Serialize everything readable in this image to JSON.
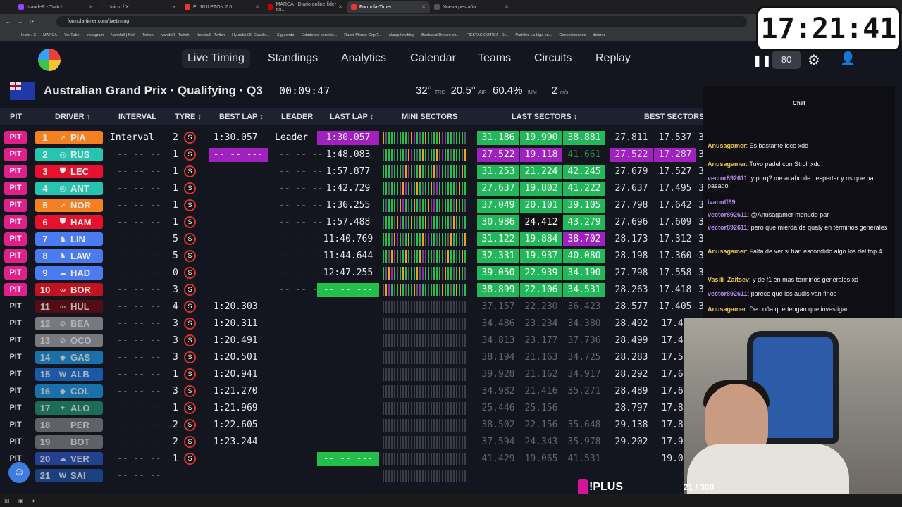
{
  "browser": {
    "tabs": [
      "tvandeR - Twitch",
      "Inicio / X",
      "EL RULETON 2.0",
      "MARCA - Diario online líder en...",
      "Formula-Timer",
      "Nueva pestaña"
    ],
    "url": "formula-timer.com/livetiming",
    "bookmarks": [
      "Inicio / X",
      "MARCA",
      "YouTube",
      "Instagram",
      "Nancla3 | Kick",
      "Twitch",
      "tvandeR - Twitch",
      "Nancla3 - Twitch",
      "Hyundai i30 Gasolin...",
      "Siguiendo",
      "Estado del servicio...",
      "Razer Mouse Grip T...",
      "alangulotv.blog",
      "Backseat Drivers en...",
      "FIESTAS GUIRCA | Di...",
      "Partidos La Liga en...",
      "Concesionarios",
      "dolares"
    ]
  },
  "clock": "17:21:41",
  "nav": {
    "items": [
      "Live Timing",
      "Standings",
      "Analytics",
      "Calendar",
      "Teams",
      "Circuits",
      "Replay"
    ],
    "speed": "80"
  },
  "session": {
    "title": "Australian Grand Prix · Qualifying · Q3",
    "timer": "00:09:47",
    "track_temp": "32°",
    "track_label": "TRC",
    "air_temp": "20.5°",
    "air_label": "AIR",
    "humidity": "60.4%",
    "hum_label": "HUM",
    "wind": "2",
    "wind_unit": "m/s"
  },
  "headers": [
    "PIT",
    "DRIVER ↑",
    "INTERVAL",
    "TYRE ↕",
    "BEST LAP ↕",
    "LEADER",
    "LAST LAP ↕",
    "MINI SECTORS",
    "LAST SECTORS ↕",
    "BEST SECTORS"
  ],
  "rows": [
    {
      "pit": "PIT",
      "pos": "1",
      "code": "PIA",
      "icon": "➚",
      "color": "#f58020",
      "interval": "Interval",
      "laps": "2",
      "best": "1:30.057",
      "leader": "Leader",
      "last": "1:30.057",
      "last_bg": "#a020c0",
      "s": [
        "31.186",
        "19.990",
        "38.881"
      ],
      "sbg": [
        "#22b85a",
        "#22b85a",
        "#22b85a"
      ],
      "b": [
        "27.811",
        "17.537",
        "3"
      ]
    },
    {
      "pit": "PIT",
      "pos": "2",
      "code": "RUS",
      "icon": "◎",
      "color": "#27c4b0",
      "interval": "-- -- --",
      "laps": "1",
      "best": "-- -- ---",
      "leader": "-- -- --",
      "last": "1:48.083",
      "last_bg": "",
      "s": [
        "27.522",
        "19.118",
        "41.661"
      ],
      "sbg": [
        "#a020c0",
        "#a020c0",
        ""
      ],
      "b": [
        "27.522",
        "17.287",
        "3"
      ]
    },
    {
      "pit": "PIT",
      "pos": "3",
      "code": "LEC",
      "icon": "⛊",
      "color": "#e8112d",
      "interval": "-- -- --",
      "laps": "1",
      "best": "",
      "leader": "-- -- --",
      "last": "1:57.877",
      "last_bg": "",
      "s": [
        "31.253",
        "21.224",
        "42.245"
      ],
      "sbg": [
        "",
        "",
        ""
      ],
      "b": [
        "27.679",
        "17.527",
        "3"
      ]
    },
    {
      "pit": "PIT",
      "pos": "4",
      "code": "ANT",
      "icon": "◎",
      "color": "#27c4b0",
      "interval": "-- -- --",
      "laps": "1",
      "best": "",
      "leader": "-- -- --",
      "last": "1:42.729",
      "last_bg": "",
      "s": [
        "27.637",
        "19.802",
        "41.222"
      ],
      "sbg": [
        "",
        "",
        ""
      ],
      "b": [
        "27.637",
        "17.495",
        "3"
      ]
    },
    {
      "pit": "PIT",
      "pos": "5",
      "code": "NOR",
      "icon": "➚",
      "color": "#f58020",
      "interval": "-- -- --",
      "laps": "1",
      "best": "",
      "leader": "-- -- --",
      "last": "1:36.255",
      "last_bg": "",
      "s": [
        "37.049",
        "20.101",
        "39.105"
      ],
      "sbg": [
        "",
        "",
        ""
      ],
      "b": [
        "27.798",
        "17.642",
        "3"
      ]
    },
    {
      "pit": "PIT",
      "pos": "6",
      "code": "HAM",
      "icon": "⛊",
      "color": "#e8112d",
      "interval": "-- -- --",
      "laps": "1",
      "best": "",
      "leader": "-- -- --",
      "last": "1:57.488",
      "last_bg": "",
      "s": [
        "30.986",
        "24.412",
        "43.279"
      ],
      "sbg": [
        "",
        "#111",
        ""
      ],
      "b": [
        "27.696",
        "17.609",
        "3"
      ]
    },
    {
      "pit": "PIT",
      "pos": "7",
      "code": "LIN",
      "icon": "♞",
      "color": "#4b7bf0",
      "interval": "-- -- --",
      "laps": "5",
      "best": "",
      "leader": "-- -- --",
      "last": "11:40.769",
      "last_bg": "",
      "s": [
        "31.122",
        "19.884",
        "38.702"
      ],
      "sbg": [
        "",
        "",
        "#a020c0"
      ],
      "b": [
        "28.173",
        "17.312",
        "3"
      ]
    },
    {
      "pit": "PIT",
      "pos": "8",
      "code": "LAW",
      "icon": "♞",
      "color": "#4b7bf0",
      "interval": "-- -- --",
      "laps": "5",
      "best": "",
      "leader": "-- -- --",
      "last": "11:44.644",
      "last_bg": "",
      "s": [
        "32.331",
        "19.937",
        "40.080"
      ],
      "sbg": [
        "",
        "",
        ""
      ],
      "b": [
        "28.198",
        "17.360",
        "3"
      ]
    },
    {
      "pit": "PIT",
      "pos": "9",
      "code": "HAD",
      "icon": "☁",
      "color": "#4b7bf0",
      "interval": "-- -- --",
      "laps": "0",
      "best": "",
      "leader": "-- -- --",
      "last": "12:47.255",
      "last_bg": "",
      "s": [
        "39.050",
        "22.939",
        "34.190"
      ],
      "sbg": [
        "",
        "",
        ""
      ],
      "b": [
        "27.798",
        "17.558",
        "3"
      ]
    },
    {
      "pit": "PIT",
      "pos": "10",
      "code": "BOR",
      "icon": "∞",
      "color": "#c0121f",
      "interval": "-- -- --",
      "laps": "3",
      "best": "",
      "leader": "-- -- --",
      "last": "-- -- ---",
      "last_bg": "#22c04a",
      "s": [
        "38.899",
        "22.106",
        "34.531"
      ],
      "sbg": [
        "",
        "",
        ""
      ],
      "b": [
        "28.263",
        "17.418",
        "3"
      ]
    },
    {
      "pit": "PIT",
      "pos": "11",
      "code": "HUL",
      "icon": "∞",
      "color": "#6a0a12",
      "interval": "-- -- --",
      "laps": "4",
      "best": "1:20.303",
      "leader": "",
      "last": "",
      "last_bg": "",
      "s": [
        "37.157",
        "22.230",
        "36.423"
      ],
      "sbg": [
        "",
        "",
        ""
      ],
      "b": [
        "28.577",
        "17.405",
        "3"
      ]
    },
    {
      "pit": "PIT",
      "pos": "12",
      "code": "BEA",
      "icon": "⊘",
      "color": "#9a9aa0",
      "interval": "-- -- --",
      "laps": "3",
      "best": "1:20.311",
      "leader": "",
      "last": "",
      "last_bg": "",
      "s": [
        "34.486",
        "23.234",
        "34.380"
      ],
      "sbg": [
        "",
        "",
        ""
      ],
      "b": [
        "28.492",
        "17.40",
        ""
      ]
    },
    {
      "pit": "PIT",
      "pos": "13",
      "code": "OCO",
      "icon": "⊘",
      "color": "#9a9aa0",
      "interval": "-- -- --",
      "laps": "3",
      "best": "1:20.491",
      "leader": "",
      "last": "",
      "last_bg": "",
      "s": [
        "34.813",
        "23.177",
        "37.736"
      ],
      "sbg": [
        "",
        "",
        ""
      ],
      "b": [
        "28.499",
        "17.46",
        ""
      ]
    },
    {
      "pit": "PIT",
      "pos": "14",
      "code": "GAS",
      "icon": "◆",
      "color": "#1d8fd6",
      "interval": "-- -- --",
      "laps": "3",
      "best": "1:20.501",
      "leader": "",
      "last": "",
      "last_bg": "",
      "s": [
        "38.194",
        "21.163",
        "34.725"
      ],
      "sbg": [
        "",
        "",
        ""
      ],
      "b": [
        "28.283",
        "17.55",
        ""
      ]
    },
    {
      "pit": "PIT",
      "pos": "15",
      "code": "ALB",
      "icon": "W",
      "color": "#1d6fd6",
      "interval": "-- -- --",
      "laps": "1",
      "best": "1:20.941",
      "leader": "",
      "last": "",
      "last_bg": "",
      "s": [
        "39.928",
        "21.162",
        "34.917"
      ],
      "sbg": [
        "",
        "",
        ""
      ],
      "b": [
        "28.292",
        "17.67",
        ""
      ]
    },
    {
      "pit": "PIT",
      "pos": "16",
      "code": "COL",
      "icon": "◆",
      "color": "#1d8fd6",
      "interval": "-- -- --",
      "laps": "3",
      "best": "1:21.270",
      "leader": "",
      "last": "",
      "last_bg": "",
      "s": [
        "34.982",
        "21.416",
        "35.271"
      ],
      "sbg": [
        "",
        "",
        ""
      ],
      "b": [
        "28.489",
        "17.62",
        ""
      ]
    },
    {
      "pit": "PIT",
      "pos": "17",
      "code": "ALO",
      "icon": "✦",
      "color": "#1f8a6a",
      "interval": "-- -- --",
      "laps": "1",
      "best": "1:21.969",
      "leader": "",
      "last": "",
      "last_bg": "",
      "s": [
        "25.446",
        "25.156",
        "",
        ""
      ],
      "sbg": [
        "",
        "",
        ""
      ],
      "b": [
        "28.797",
        "17.80",
        ""
      ]
    },
    {
      "pit": "PIT",
      "pos": "18",
      "code": "PER",
      "icon": "",
      "color": "#7a7a80",
      "interval": "-- -- --",
      "laps": "2",
      "best": "1:22.605",
      "leader": "",
      "last": "",
      "last_bg": "",
      "s": [
        "38.502",
        "22.156",
        "35.648"
      ],
      "sbg": [
        "",
        "",
        ""
      ],
      "b": [
        "29.138",
        "17.81",
        ""
      ]
    },
    {
      "pit": "PIT",
      "pos": "19",
      "code": "BOT",
      "icon": "",
      "color": "#7a7a80",
      "interval": "-- -- --",
      "laps": "2",
      "best": "1:23.244",
      "leader": "",
      "last": "",
      "last_bg": "",
      "s": [
        "37.594",
        "24.343",
        "35.978"
      ],
      "sbg": [
        "",
        "",
        ""
      ],
      "b": [
        "29.202",
        "17.94",
        ""
      ]
    },
    {
      "pit": "PIT",
      "pos": "20",
      "code": "VER",
      "icon": "☁",
      "color": "#2a4fb8",
      "interval": "-- -- --",
      "laps": "1",
      "best": "",
      "leader": "",
      "last": "-- -- ---",
      "last_bg": "#22c04a",
      "s": [
        "41.429",
        "19.065",
        "41.531"
      ],
      "sbg": [
        "",
        "",
        ""
      ],
      "b": [
        "",
        "19.06",
        ""
      ]
    },
    {
      "pit": "PIT",
      "pos": "21",
      "code": "SAI",
      "icon": "W",
      "color": "#1d4fa0",
      "interval": "-- -- --",
      "laps": "",
      "best": "",
      "leader": "",
      "last": "",
      "last_bg": "",
      "s": [
        "",
        "",
        ""
      ],
      "sbg": [
        "",
        "",
        ""
      ],
      "b": [
        "",
        "",
        ""
      ]
    }
  ],
  "chat": {
    "title": "Chat",
    "messages": [
      {
        "user": "Anusagamer",
        "text": "Es bastante loco xdd",
        "cls": "y"
      },
      {
        "user": "Anusagamer",
        "text": "Tuvo padel con Stroll xdd",
        "cls": "y"
      },
      {
        "user": "vector892611",
        "text": "y porq? me acabo de despertar y ns que ha pasado",
        "cls": ""
      },
      {
        "user": "ivanoff69",
        "text": "",
        "cls": ""
      },
      {
        "user": "vector892611",
        "text": "@Anusagamer menudo par",
        "cls": ""
      },
      {
        "user": "vector892611",
        "text": "pero que mierda de qualy en términos generales",
        "cls": ""
      },
      {
        "user": "Anusagamer",
        "text": "Falta de ver si han escondido algo los del top 4",
        "cls": "y"
      },
      {
        "user": "Vasili_Zaitsev",
        "text": "y de f1 en mas terminos generales xd",
        "cls": "y"
      },
      {
        "user": "vector892611",
        "text": "parece que los audis van finos",
        "cls": ""
      },
      {
        "user": "Anusagamer",
        "text": "De coña que tengan que investigar",
        "cls": "y"
      }
    ]
  },
  "overlay": {
    "plus": "!PLUS",
    "counter": "21 / 300"
  }
}
